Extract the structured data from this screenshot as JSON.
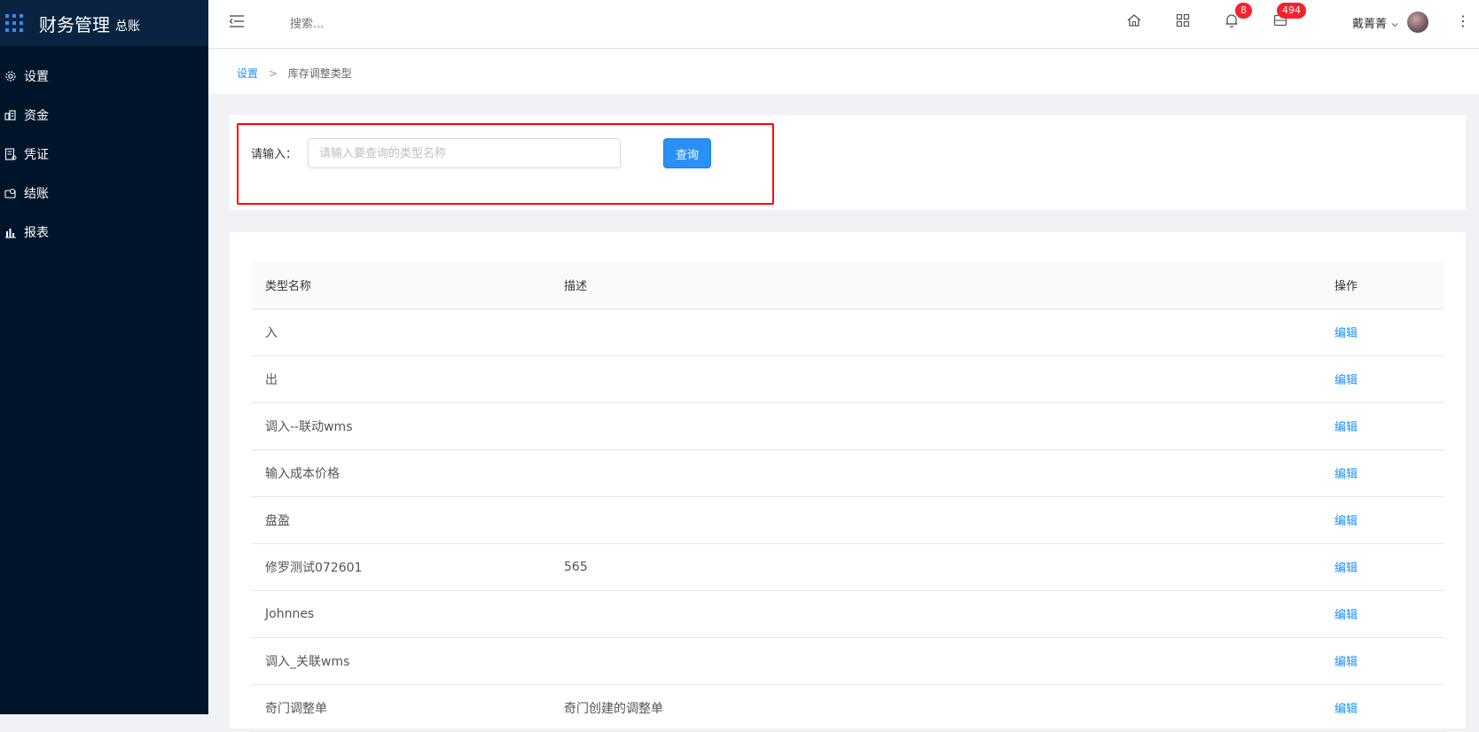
{
  "app": {
    "title": "财务管理",
    "subtitle": "总账"
  },
  "sidebar": {
    "items": [
      {
        "label": "设置",
        "icon": "gear-icon"
      },
      {
        "label": "资金",
        "icon": "funds-icon"
      },
      {
        "label": "凭证",
        "icon": "voucher-icon"
      },
      {
        "label": "结账",
        "icon": "checkout-icon"
      },
      {
        "label": "报表",
        "icon": "chart-icon"
      }
    ]
  },
  "header": {
    "search_placeholder": "搜索...",
    "notifications_count": "8",
    "messages_count": "494",
    "user_name": "戴菁菁",
    "more_glyph": "⋮"
  },
  "breadcrumb": {
    "root": "设置",
    "separator": ">",
    "current": "库存调整类型"
  },
  "filter": {
    "label": "请输入：",
    "input_placeholder": "请输入要查询的类型名称",
    "input_value": "",
    "query_button": "查询"
  },
  "table": {
    "headers": [
      "类型名称",
      "描述",
      "操作"
    ],
    "rows": [
      {
        "name": "入",
        "desc": "",
        "action": "编辑"
      },
      {
        "name": "出",
        "desc": "",
        "action": "编辑"
      },
      {
        "name": "调入--联动wms",
        "desc": "",
        "action": "编辑"
      },
      {
        "name": "输入成本价格",
        "desc": "",
        "action": "编辑"
      },
      {
        "name": "盘盈",
        "desc": "",
        "action": "编辑"
      },
      {
        "name": "修罗测试072601",
        "desc": "565",
        "action": "编辑"
      },
      {
        "name": "Johnnes",
        "desc": "",
        "action": "编辑"
      },
      {
        "name": "调入_关联wms",
        "desc": "",
        "action": "编辑"
      },
      {
        "name": "奇门调整单",
        "desc": "奇门创建的调整单",
        "action": "编辑"
      }
    ]
  },
  "colors": {
    "sidebar_bg": "#001529",
    "accent": "#1890ff",
    "button": "#2b90f5",
    "badge": "#f5222d",
    "highlight_frame": "#ff0000"
  }
}
